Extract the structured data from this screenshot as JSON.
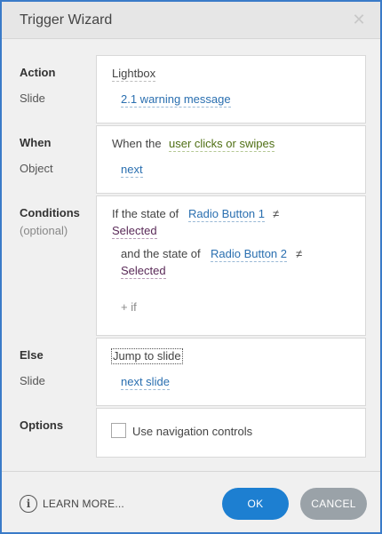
{
  "window": {
    "title": "Trigger Wizard",
    "close_glyph": "✕"
  },
  "action": {
    "label": "Action",
    "value": "Lightbox",
    "slide_label": "Slide",
    "slide_value": "2.1 warning message"
  },
  "when": {
    "label": "When",
    "prefix": "When the",
    "event": "user clicks or swipes",
    "object_label": "Object",
    "object_value": "next"
  },
  "conditions": {
    "label": "Conditions",
    "hint": "(optional)",
    "rows": [
      {
        "prefix": "If the state of",
        "object": "Radio Button 1",
        "operator": "≠",
        "value": "Selected"
      },
      {
        "prefix": "and the state of",
        "object": "Radio Button 2",
        "operator": "≠",
        "value": "Selected"
      }
    ],
    "add_if": "+ if"
  },
  "else": {
    "label": "Else",
    "action": "Jump to slide",
    "slide_label": "Slide",
    "slide_value": "next slide"
  },
  "options": {
    "label": "Options",
    "checkbox_label": "Use navigation controls",
    "checked": false
  },
  "footer": {
    "learn_more": "LEARN MORE...",
    "info_glyph": "i",
    "ok": "OK",
    "cancel": "CANCEL"
  },
  "colors": {
    "accent": "#1d7fd1",
    "cancel": "#9aa2a8",
    "window_border": "#3a7bc8",
    "link_blue": "#2a6fb0",
    "link_green": "#4f6f14",
    "link_purple": "#5a2a58"
  },
  "icons": {
    "close": "close-icon",
    "info": "info-icon"
  }
}
